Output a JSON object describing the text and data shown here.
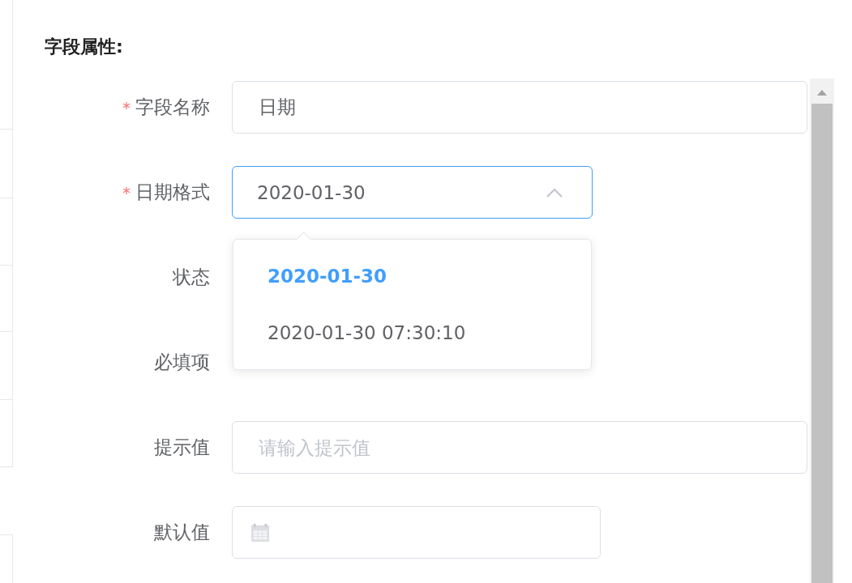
{
  "section_title": "字段属性:",
  "fields": [
    {
      "label": "字段名称",
      "required": true,
      "required_mark": "*",
      "kind": "text",
      "value": "日期"
    },
    {
      "label": "日期格式",
      "required": true,
      "required_mark": "*",
      "kind": "select",
      "value": "2020-01-30",
      "expanded": true,
      "options": [
        {
          "label": "2020-01-30",
          "selected": true
        },
        {
          "label": "2020-01-30 07:30:10",
          "selected": false
        }
      ]
    },
    {
      "label": "状态",
      "required": false,
      "kind": "covered"
    },
    {
      "label": "必填项",
      "required": false,
      "kind": "covered"
    },
    {
      "label": "提示值",
      "required": false,
      "kind": "text",
      "placeholder": "请输入提示值"
    },
    {
      "label": "默认值",
      "required": false,
      "kind": "date"
    }
  ]
}
